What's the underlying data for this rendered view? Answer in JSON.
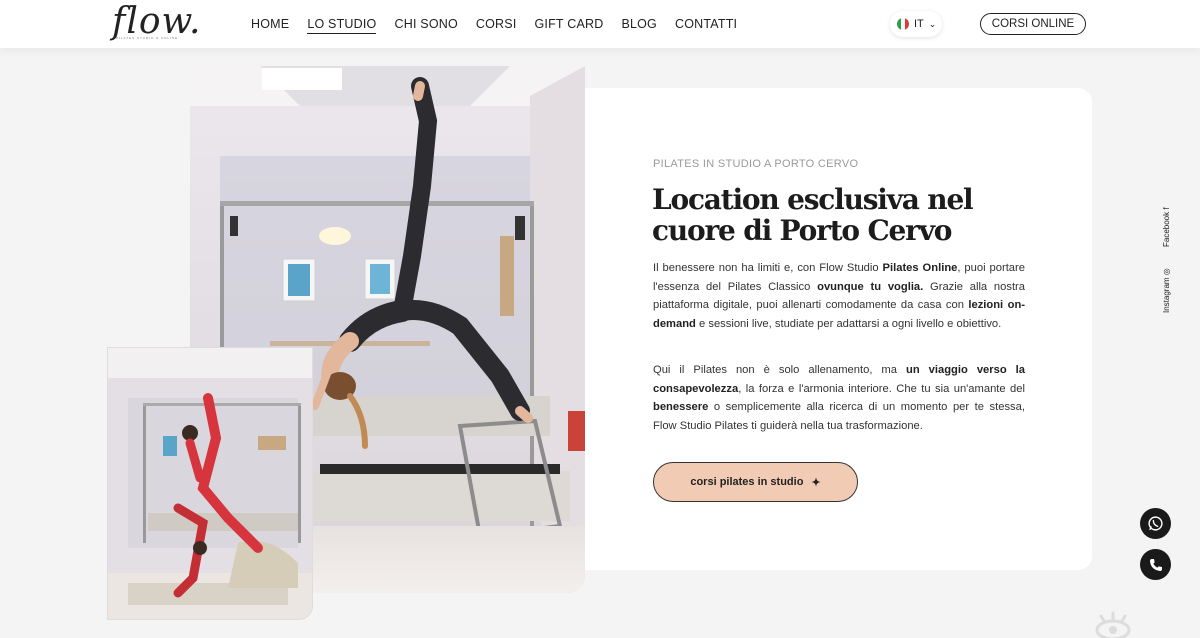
{
  "header": {
    "logo": "flow.",
    "logo_tagline": "PILATES STUDIO & ONLINE",
    "nav": [
      {
        "label": "HOME"
      },
      {
        "label": "LO STUDIO"
      },
      {
        "label": "CHI SONO"
      },
      {
        "label": "CORSI"
      },
      {
        "label": "GIFT CARD"
      },
      {
        "label": "BLOG"
      },
      {
        "label": "CONTATTI"
      }
    ],
    "active_nav": "LO STUDIO",
    "language": "IT",
    "online_button": "CORSI ONLINE"
  },
  "section": {
    "eyebrow": "PILATES IN STUDIO A PORTO CERVO",
    "title": "Location esclusiva nel cuore di Porto Cervo",
    "paragraph1": [
      {
        "t": "Il benessere non ha limiti e, con Flow Studio ",
        "b": false
      },
      {
        "t": "Pilates Online",
        "b": true
      },
      {
        "t": ", puoi portare l'essenza del Pilates Classico ",
        "b": false
      },
      {
        "t": "ovunque tu voglia.",
        "b": true
      },
      {
        "t": " Grazie alla nostra piattaforma digitale, puoi allenarti comodamente da casa con ",
        "b": false
      },
      {
        "t": "lezioni on-demand",
        "b": true
      },
      {
        "t": " e sessioni live, studiate per adattarsi a ogni livello e obiettivo.",
        "b": false
      }
    ],
    "paragraph2": [
      {
        "t": "Qui il Pilates non è solo allenamento, ma ",
        "b": false
      },
      {
        "t": "un viaggio verso la consapevolezza",
        "b": true
      },
      {
        "t": ", la forza e l'armonia interiore. Che tu sia un'amante del ",
        "b": false
      },
      {
        "t": "benessere",
        "b": true
      },
      {
        "t": " o semplicemente alla ricerca di un momento per te stessa, Flow Studio Pilates ti guiderà nella tua trasformazione.",
        "b": false
      }
    ],
    "cta_label": "corsi pilates in studio",
    "cta_icon": "✦"
  },
  "social": {
    "facebook": "Facebook",
    "instagram": "Instagram"
  },
  "icons": {
    "whatsapp": "whatsapp-icon",
    "phone": "phone-icon"
  },
  "colors": {
    "cta_bg": "#f2cbb4",
    "fab_bg": "#1a1a1a",
    "page_bg": "#f4f4f4"
  }
}
